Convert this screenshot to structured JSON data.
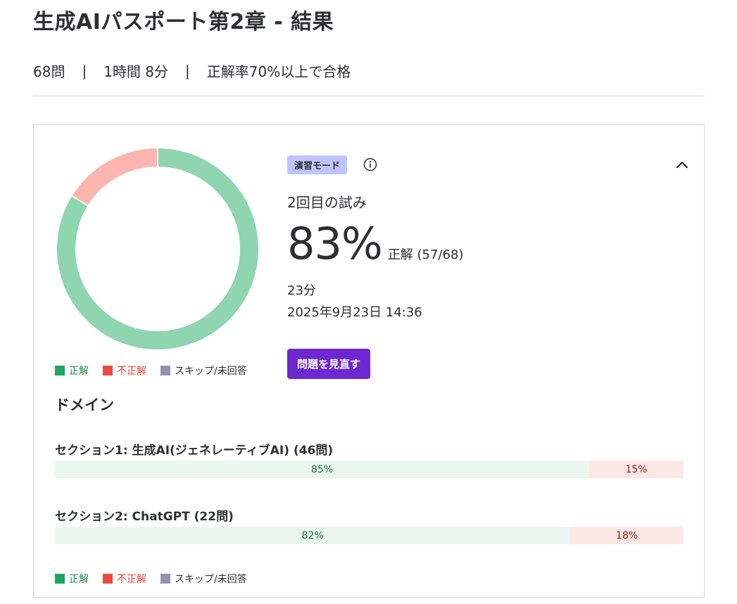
{
  "header": {
    "title": "生成AIパスポート第2章 - 結果",
    "question_count": "68問",
    "time_limit": "1時間 8分",
    "pass_rule": "正解率70%以上で合格",
    "separator": "|"
  },
  "result": {
    "mode_badge": "演習モード",
    "attempt": "2回目の試み",
    "score_percent": "83%",
    "score_detail": "正解 (57/68)",
    "duration": "23分",
    "datetime": "2025年9月23日 14:36",
    "review_button": "問題を見直す",
    "donut": {
      "correct": 57,
      "incorrect": 11,
      "skipped": 0
    }
  },
  "legend": {
    "correct": "正解",
    "incorrect": "不正解",
    "skipped": "スキップ/未回答"
  },
  "domains": {
    "heading": "ドメイン",
    "sections": [
      {
        "title": "セクション1: 生成AI(ジェネレーティブAI) (46問)",
        "correct_pct": 85,
        "correct_label": "85%",
        "incorrect_label": "15%"
      },
      {
        "title": "セクション2: ChatGPT (22問)",
        "correct_pct": 82,
        "correct_label": "82%",
        "incorrect_label": "18%"
      }
    ]
  },
  "colors": {
    "correct": "#1ea55f",
    "incorrect": "#ef4b3c",
    "skipped": "#9194ac",
    "donut_correct": "#8fd5b0",
    "donut_incorrect": "#fdb6af",
    "accent": "#6d28d2",
    "badge_bg": "#c0c4fc"
  },
  "icons": {
    "info": "info-icon",
    "collapse": "chevron-up-icon"
  }
}
